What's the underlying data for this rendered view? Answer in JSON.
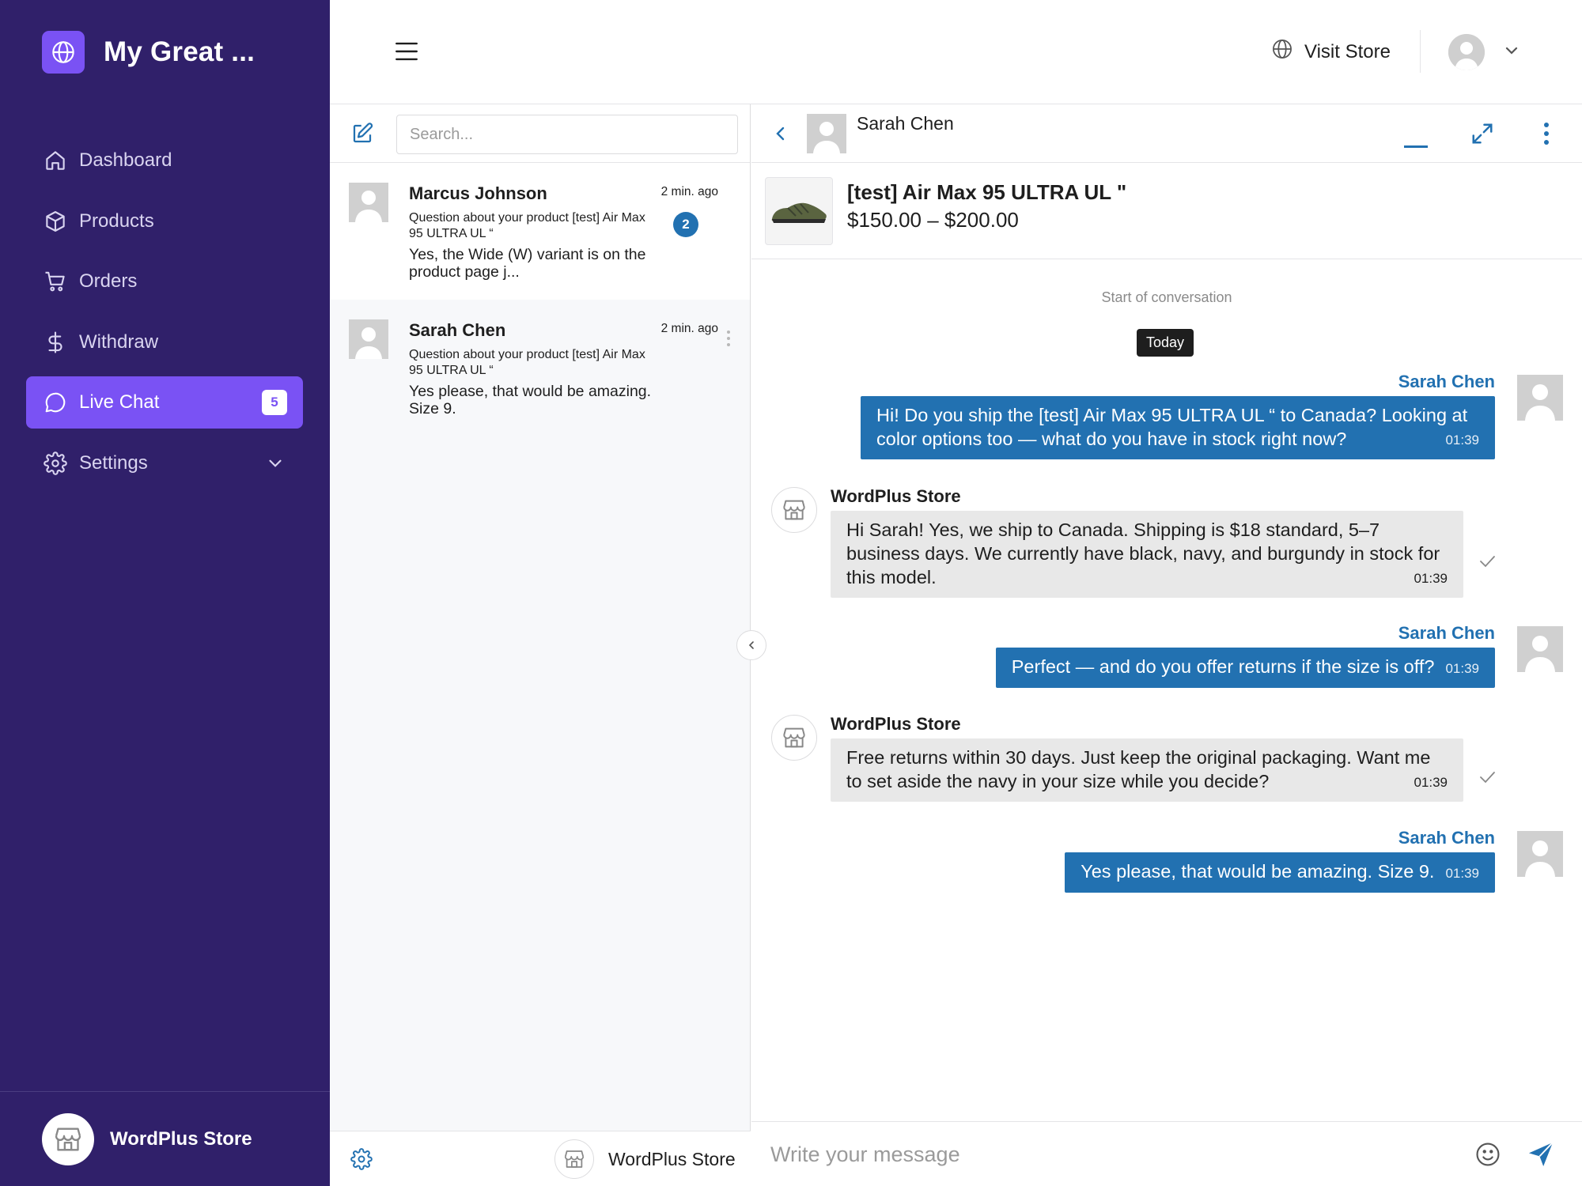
{
  "sidebar": {
    "brand_title": "My Great ...",
    "items": [
      {
        "label": "Dashboard",
        "icon": "home-icon"
      },
      {
        "label": "Products",
        "icon": "box-icon"
      },
      {
        "label": "Orders",
        "icon": "cart-icon"
      },
      {
        "label": "Withdraw",
        "icon": "dollar-icon"
      },
      {
        "label": "Live Chat",
        "icon": "chat-bubble-icon",
        "active": true,
        "badge": "5"
      },
      {
        "label": "Settings",
        "icon": "gear-icon"
      }
    ],
    "footer_store_name": "WordPlus Store"
  },
  "topbar": {
    "visit_store_label": "Visit Store"
  },
  "conversations": {
    "search_placeholder": "Search...",
    "items": [
      {
        "name": "Marcus Johnson",
        "subject": "Question about your product [test] Air Max 95 ULTRA UL “",
        "preview": "Yes, the Wide (W) variant is on the product page j...",
        "time": "2 min. ago",
        "unread": "2"
      },
      {
        "name": "Sarah Chen",
        "subject": "Question about your product [test] Air Max 95 ULTRA UL “",
        "preview": "Yes please, that would be amazing. Size 9.",
        "time": "2 min. ago"
      }
    ],
    "footer_store_name": "WordPlus Store"
  },
  "chat": {
    "contact_name": "Sarah Chen",
    "product": {
      "name": "[test] Air Max 95 ULTRA UL \"",
      "price": "$150.00 – $200.00"
    },
    "start_label": "Start of conversation",
    "date_label": "Today",
    "messages": [
      {
        "direction": "out",
        "sender": "Sarah Chen",
        "text": "Hi! Do you ship the [test] Air Max 95 ULTRA UL “ to Canada? Looking at color options too — what do you have in stock right now?",
        "time": "01:39"
      },
      {
        "direction": "in",
        "sender": "WordPlus Store",
        "text": "Hi Sarah! Yes, we ship to Canada. Shipping is $18 standard, 5–7 business days. We currently have black, navy, and burgundy in stock for this model.",
        "time": "01:39"
      },
      {
        "direction": "out",
        "sender": "Sarah Chen",
        "text": "Perfect — and do you offer returns if the size is off?",
        "time": "01:39"
      },
      {
        "direction": "in",
        "sender": "WordPlus Store",
        "text": "Free returns within 30 days. Just keep the original packaging. Want me to set aside the navy in your size while you decide?",
        "time": "01:39"
      },
      {
        "direction": "out",
        "sender": "Sarah Chen",
        "text": "Yes please, that would be amazing. Size 9.",
        "time": "01:39"
      }
    ],
    "composer_placeholder": "Write your message"
  },
  "colors": {
    "sidebar_bg": "#30206a",
    "accent_purple": "#7a52f4",
    "chat_blue": "#2271b1",
    "incoming_bubble": "#e8e8e8"
  }
}
